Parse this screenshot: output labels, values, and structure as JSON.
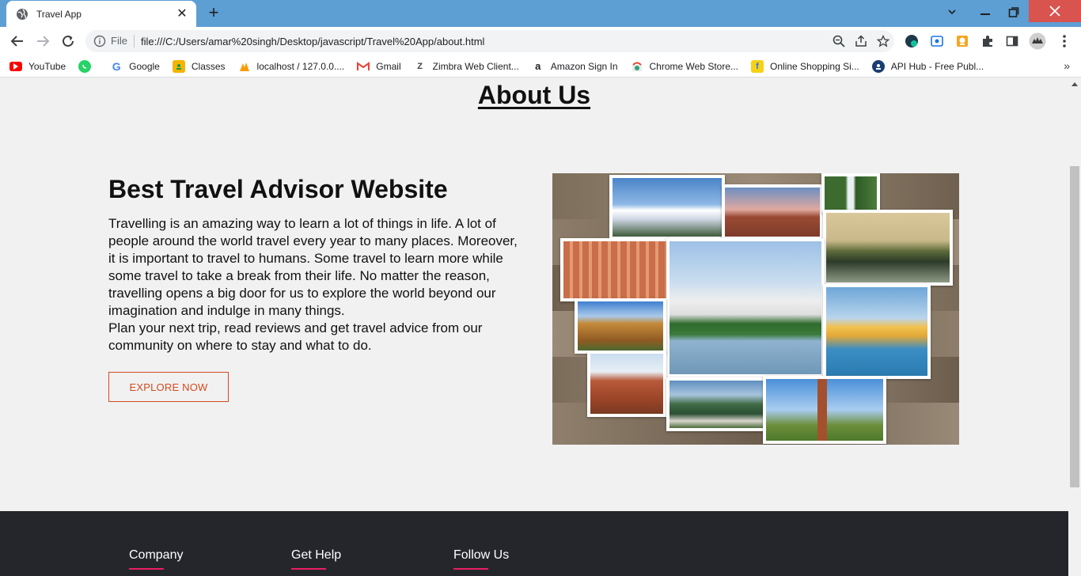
{
  "browser": {
    "tab_title": "Travel App",
    "new_tab": "+",
    "omnibox_scheme": "File",
    "url": "file:///C:/Users/amar%20singh/Desktop/javascript/Travel%20App/about.html",
    "bookmarks": [
      {
        "label": "YouTube",
        "icon": "youtube-icon",
        "color": "#ff0000"
      },
      {
        "label": "Google",
        "icon": "google-icon",
        "color": "#4285f4"
      },
      {
        "label": "Classes",
        "icon": "classroom-icon",
        "color": "#f4b400"
      },
      {
        "label": "localhost / 127.0.0....",
        "icon": "phpmyadmin-icon",
        "color": "#f89c0e"
      },
      {
        "label": "Gmail",
        "icon": "gmail-icon",
        "color": "#ea4335"
      },
      {
        "label": "Zimbra Web Client...",
        "icon": "zimbra-icon",
        "color": "#444444"
      },
      {
        "label": "Amazon Sign In",
        "icon": "amazon-icon",
        "color": "#222222"
      },
      {
        "label": "Chrome Web Store...",
        "icon": "chrome-webstore-icon",
        "color": "#34a853"
      },
      {
        "label": "Online Shopping Si...",
        "icon": "flipkart-icon",
        "color": "#f7d117"
      },
      {
        "label": "API Hub - Free Publ...",
        "icon": "api-hub-icon",
        "color": "#1a3e72"
      }
    ],
    "bookmarks_more": "»"
  },
  "page": {
    "heading": "About Us",
    "hero_title": "Best Travel Advisor Website",
    "hero_paragraph_1": "Travelling is an amazing way to learn a lot of things in life. A lot of people around the world travel every year to many places. Moreover, it is important to travel to humans. Some travel to learn more while some travel to take a break from their life. No matter the reason, travelling opens a big door for us to explore the world beyond our imagination and indulge in many things.",
    "hero_paragraph_2": "Plan your next trip, read reviews and get travel advice from our community on where to stay and what to do.",
    "explore_label": "EXPLORE NOW"
  },
  "footer": {
    "columns": [
      {
        "title": "Company"
      },
      {
        "title": "Get Help"
      },
      {
        "title": "Follow Us"
      }
    ],
    "accent": "#e91e63"
  },
  "colors": {
    "tabbar": "#5d9ed3",
    "accent_button": "#d34a1f",
    "footer_bg": "#24262b"
  }
}
